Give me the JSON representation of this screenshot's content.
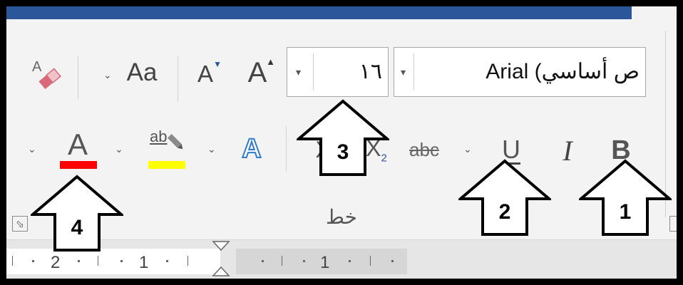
{
  "font_group": {
    "label": "خط",
    "font_name": "ص أساسي) Arial",
    "font_size": "١٦",
    "grow_font_letter": "A",
    "shrink_font_letter": "A",
    "change_case_label": "Aa",
    "bold_label": "B",
    "italic_label": "I",
    "underline_label": "U",
    "strikethrough_label": "abc",
    "subscript_label": "X",
    "subscript_mark": "2",
    "superscript_label": "X",
    "text_effects_label": "A",
    "highlight_label": "ab",
    "font_color_label": "A"
  },
  "colors": {
    "title_bar": "#2b579a",
    "highlight_color": "#ffff00",
    "font_color": "#ff0000",
    "text_effects_outline": "#2e7bcf"
  },
  "ruler": {
    "numbers": [
      "2",
      "1",
      "1"
    ]
  },
  "callouts": [
    "1",
    "2",
    "3",
    "4"
  ],
  "icons": [
    "clear-formatting-icon",
    "grow-font-icon",
    "shrink-font-icon",
    "change-case-icon",
    "bold-icon",
    "italic-icon",
    "underline-icon",
    "strikethrough-icon",
    "subscript-icon",
    "superscript-icon",
    "text-effects-icon",
    "highlight-icon",
    "font-color-icon",
    "dialog-launcher-icon"
  ]
}
